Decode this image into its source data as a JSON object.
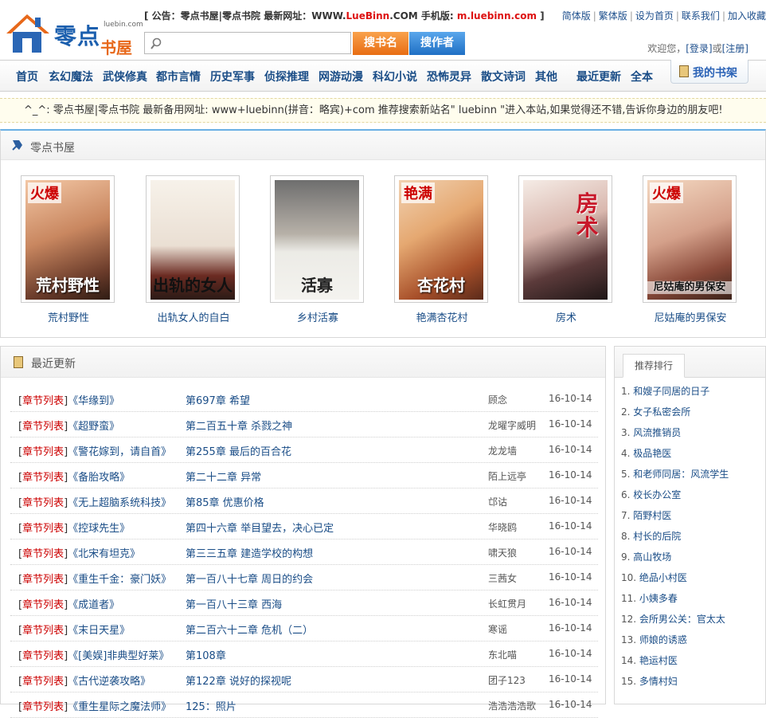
{
  "logo": {
    "main": "零点",
    "sub": "书屋",
    "domain": "luebin.com"
  },
  "notice": {
    "prefix": "[ 公告：零点书屋|零点书院 最新网址：WWW.",
    "domain_red": "LueBinn",
    "mid": ".COM 手机版: ",
    "mobile_red": "m.luebinn.com",
    "suffix": " ]"
  },
  "toplinks": [
    "简体版",
    "繁体版",
    "设为首页",
    "联系我们",
    "加入收藏"
  ],
  "search": {
    "placeholder": "",
    "btn_name": "搜书名",
    "btn_author": "搜作者"
  },
  "welcome": {
    "text": "欢迎您，",
    "login": "[登录]",
    "or": "或",
    "register": "[注册]"
  },
  "nav": [
    "首页",
    "玄幻魔法",
    "武侠修真",
    "都市言情",
    "历史军事",
    "侦探推理",
    "网游动漫",
    "科幻小说",
    "恐怖灵异",
    "散文诗词",
    "其他",
    "最近更新",
    "全本"
  ],
  "shelf": "我的书架",
  "marquee": "^_^: 零点书屋|零点书院 最新备用网址: www+luebinn(拼音：略宾)+com 推荐搜索新站名\" luebinn \"进入本站,如果觉得还不错,告诉你身边的朋友吧!",
  "featured": {
    "heading": "零点书屋",
    "books": [
      {
        "title": "荒村野性",
        "cover_text": "荒村野性",
        "tag": "火爆"
      },
      {
        "title": "出轨女人的自白",
        "cover_text": "出轨的女人",
        "tag": ""
      },
      {
        "title": "乡村活寡",
        "cover_text": "活寡",
        "tag": ""
      },
      {
        "title": "艳满杏花村",
        "cover_text": "杏花村",
        "tag": "艳满"
      },
      {
        "title": "房术",
        "cover_text": "房术",
        "tag": ""
      },
      {
        "title": "尼姑庵的男保安",
        "cover_text": "尼姑庵的男保安",
        "tag": "火爆"
      }
    ]
  },
  "latest": {
    "heading": "最近更新",
    "list_label": "章节列表",
    "rows": [
      {
        "book": "《华缘到》",
        "chapter": "第697章 希望",
        "author": "顾念",
        "date": "16-10-14"
      },
      {
        "book": "《超野蛮》",
        "chapter": "第二百五十章 杀戮之神",
        "author": "龙曜字威明",
        "date": "16-10-14"
      },
      {
        "book": "《警花嫁到，请自首》",
        "chapter": "第255章 最后的百合花",
        "author": "龙龙墙",
        "date": "16-10-14"
      },
      {
        "book": "《备胎攻略》",
        "chapter": "第二十二章 异常",
        "author": "陌上远亭",
        "date": "16-10-14"
      },
      {
        "book": "《无上超脑系统科技》",
        "chapter": "第85章 优惠价格",
        "author": "邙诂",
        "date": "16-10-14"
      },
      {
        "book": "《控球先生》",
        "chapter": "第四十六章 举目望去，决心已定",
        "author": "华晓鸥",
        "date": "16-10-14"
      },
      {
        "book": "《北宋有坦克》",
        "chapter": "第三三五章 建造学校的构想",
        "author": "啸天狼",
        "date": "16-10-14"
      },
      {
        "book": "《重生千金：豪门妖》",
        "chapter": "第一百八十七章 周日的约会",
        "author": "三茜女",
        "date": "16-10-14"
      },
      {
        "book": "《成道者》",
        "chapter": "第一百八十三章 西海",
        "author": "长虹贯月",
        "date": "16-10-14"
      },
      {
        "book": "《末日天星》",
        "chapter": "第二百六十二章 危机（二）",
        "author": "寒谣",
        "date": "16-10-14"
      },
      {
        "book": "《[美娱]非典型好莱》",
        "chapter": "第108章",
        "author": "东北喵",
        "date": "16-10-14"
      },
      {
        "book": "《古代逆袭攻略》",
        "chapter": "第122章 说好的探视呢",
        "author": "团子123",
        "date": "16-10-14"
      },
      {
        "book": "《重生星际之魔法师》",
        "chapter": "125：照片",
        "author": "浩浩浩浩歌",
        "date": "16-10-14"
      }
    ]
  },
  "rank": {
    "tab": "推荐排行",
    "items": [
      "和嫂子同居的日子",
      "女子私密会所",
      "风流推销员",
      "极品艳医",
      "和老师同居：风流学生",
      "校长办公室",
      "陌野村医",
      "村长的后院",
      "高山牧场",
      "绝品小村医",
      "小姨多春",
      "会所男公关：官太太",
      "师娘的诱惑",
      "艳运村医",
      "多情村妇"
    ]
  },
  "colors": {
    "nav_text": "#1a4d87",
    "accent_orange": "#e86d13",
    "accent_blue": "#1f6fc4",
    "red": "#cc0000"
  }
}
